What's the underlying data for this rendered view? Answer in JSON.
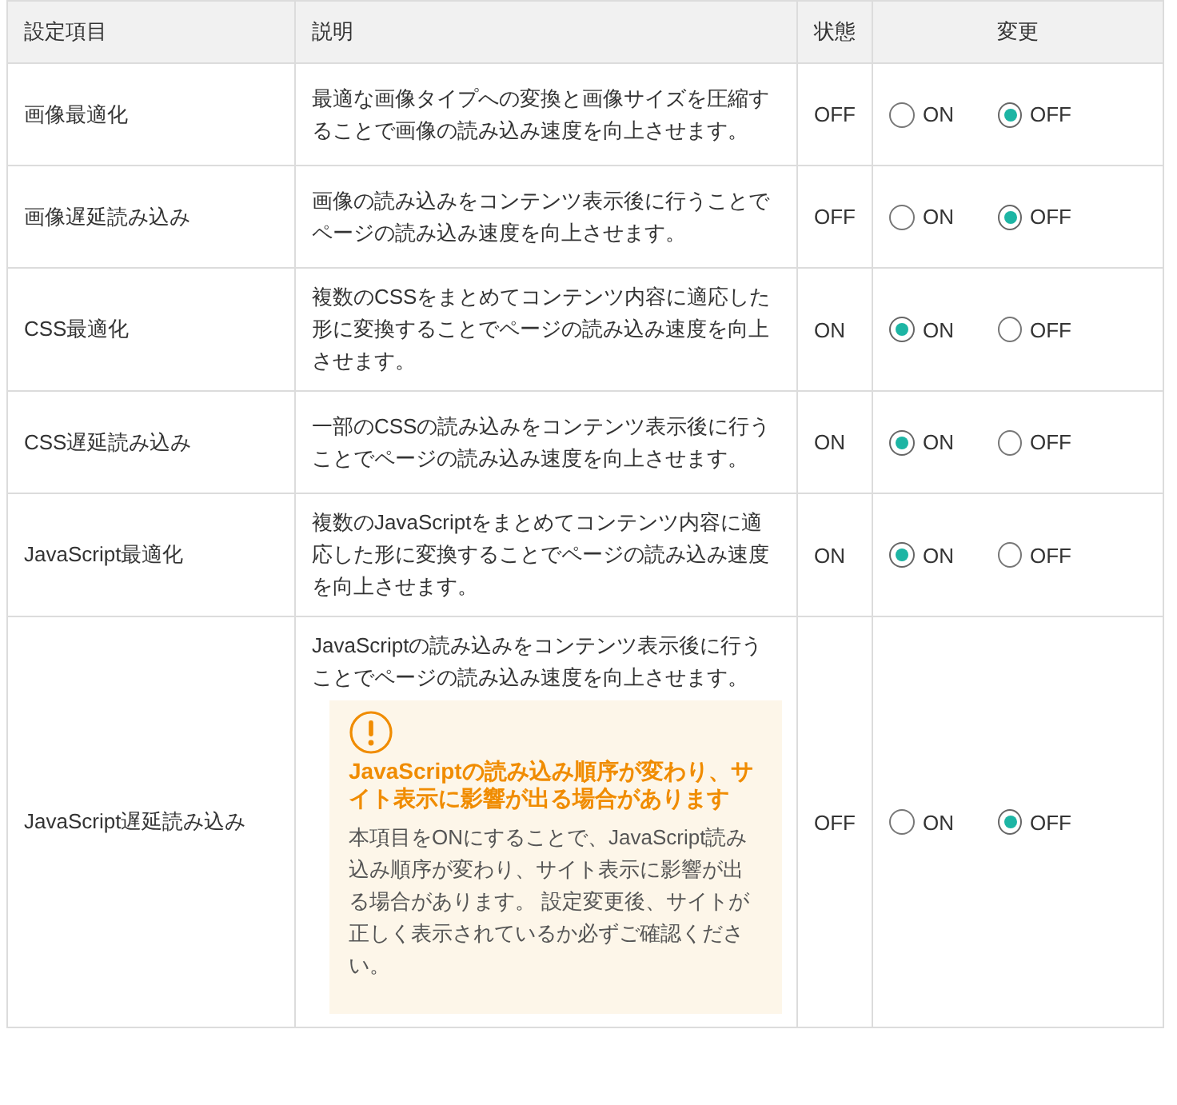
{
  "table": {
    "columns": [
      "設定項目",
      "説明",
      "状態",
      "変更"
    ],
    "rows": [
      {
        "name": "画像最適化",
        "description": "最適な画像タイプへの変換と画像サイズを圧縮することで画像の読み込み速度を向上させます。",
        "status": "OFF",
        "options": [
          {
            "label": "ON",
            "selected": false
          },
          {
            "label": "OFF",
            "selected": true
          }
        ]
      },
      {
        "name": "画像遅延読み込み",
        "description": "画像の読み込みをコンテンツ表示後に行うことでページの読み込み速度を向上させます。",
        "status": "OFF",
        "options": [
          {
            "label": "ON",
            "selected": false
          },
          {
            "label": "OFF",
            "selected": true
          }
        ]
      },
      {
        "name": "CSS最適化",
        "description": "複数のCSSをまとめてコンテンツ内容に適応した形に変換することでページの読み込み速度を向上させます。",
        "status": "ON",
        "options": [
          {
            "label": "ON",
            "selected": true
          },
          {
            "label": "OFF",
            "selected": false
          }
        ]
      },
      {
        "name": "CSS遅延読み込み",
        "description": "一部のCSSの読み込みをコンテンツ表示後に行うことでページの読み込み速度を向上させます。",
        "status": "ON",
        "options": [
          {
            "label": "ON",
            "selected": true
          },
          {
            "label": "OFF",
            "selected": false
          }
        ]
      },
      {
        "name": "JavaScript最適化",
        "description": "複数のJavaScriptをまとめてコンテンツ内容に適応した形に変換することでページの読み込み速度を向上させます。",
        "status": "ON",
        "options": [
          {
            "label": "ON",
            "selected": true
          },
          {
            "label": "OFF",
            "selected": false
          }
        ]
      },
      {
        "name": "JavaScript遅延読み込み",
        "description": "JavaScriptの読み込みをコンテンツ表示後に行うことでページの読み込み速度を向上させます。",
        "status": "OFF",
        "options": [
          {
            "label": "ON",
            "selected": false
          },
          {
            "label": "OFF",
            "selected": true
          }
        ],
        "warning": {
          "title": "JavaScriptの読み込み順序が変わり、サイト表示に影響が出る場合があります",
          "body": "本項目をONにすることで、JavaScript読み込み順序が変わり、サイト表示に影響が出る場合があります。 設定変更後、サイトが正しく表示されているか必ずご確認ください。"
        }
      }
    ]
  }
}
